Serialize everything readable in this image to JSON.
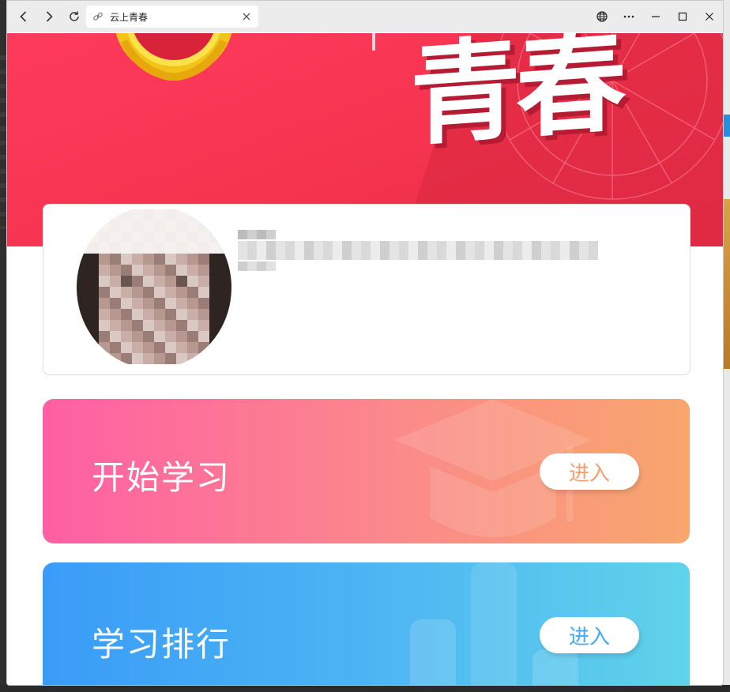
{
  "browser": {
    "tab_title": "云上青春",
    "icons": {
      "back": "back-arrow-icon",
      "forward": "forward-arrow-icon",
      "refresh": "refresh-icon",
      "link": "link-icon",
      "close_tab": "close-icon",
      "globe": "globe-icon",
      "more": "more-icon",
      "minimize": "minimize-icon",
      "maximize": "maximize-icon",
      "close_window": "close-window-icon"
    }
  },
  "banner": {
    "hero_text": "青春",
    "colors": {
      "primary": "#f5344f",
      "shadow": "#b51c33"
    }
  },
  "profile": {
    "avatar_blurred": true,
    "name_blurred": true
  },
  "actions": [
    {
      "label": "开始学习",
      "button": "进入",
      "colors": [
        "#ff5fa4",
        "#f8a66d"
      ],
      "icon": "graduation-cap-icon"
    },
    {
      "label": "学习排行",
      "button": "进入",
      "colors": [
        "#3a9cf8",
        "#5fd3ea"
      ],
      "icon": "bar-chart-icon"
    }
  ]
}
